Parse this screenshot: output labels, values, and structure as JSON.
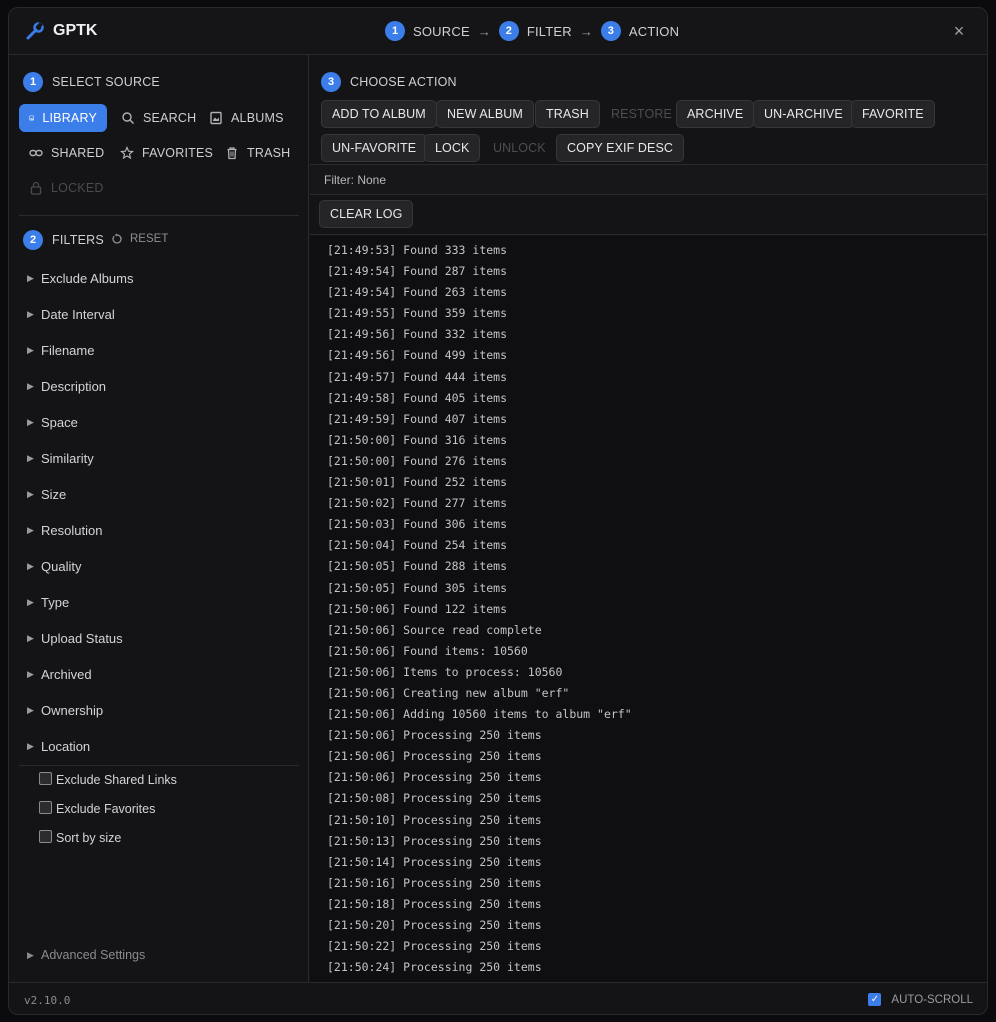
{
  "app": {
    "title": "GPTK",
    "version": "v2.10.0"
  },
  "steps": [
    {
      "num": "1",
      "label": "SOURCE"
    },
    {
      "num": "2",
      "label": "FILTER"
    },
    {
      "num": "3",
      "label": "ACTION"
    }
  ],
  "step_arrow": "→",
  "close_icon": "×",
  "source": {
    "num": "1",
    "title": "SELECT SOURCE",
    "buttons": [
      {
        "label": "LIBRARY",
        "icon": "image-icon",
        "state": "active"
      },
      {
        "label": "SEARCH",
        "icon": "search-icon",
        "state": "normal"
      },
      {
        "label": "ALBUMS",
        "icon": "album-icon",
        "state": "normal"
      },
      {
        "label": "SHARED",
        "icon": "link-icon",
        "state": "normal"
      },
      {
        "label": "FAVORITES",
        "icon": "star-icon",
        "state": "normal"
      },
      {
        "label": "TRASH",
        "icon": "trash-icon",
        "state": "normal"
      },
      {
        "label": "LOCKED",
        "icon": "lock-icon",
        "state": "disabled"
      }
    ]
  },
  "filters": {
    "num": "2",
    "title": "FILTERS",
    "reset_label": "RESET",
    "items": [
      "Exclude Albums",
      "Date Interval",
      "Filename",
      "Description",
      "Space",
      "Similarity",
      "Size",
      "Resolution",
      "Quality",
      "Type",
      "Upload Status",
      "Archived",
      "Ownership",
      "Location"
    ],
    "checkboxes": [
      {
        "label": "Exclude Shared Links",
        "checked": false
      },
      {
        "label": "Exclude Favorites",
        "checked": false
      },
      {
        "label": "Sort by size",
        "checked": false
      }
    ],
    "advanced_label": "Advanced Settings"
  },
  "actions": {
    "num": "3",
    "title": "CHOOSE ACTION",
    "buttons": [
      {
        "label": "ADD TO ALBUM",
        "enabled": true
      },
      {
        "label": "NEW ALBUM",
        "enabled": true
      },
      {
        "label": "TRASH",
        "enabled": true
      },
      {
        "label": "RESTORE",
        "enabled": false
      },
      {
        "label": "ARCHIVE",
        "enabled": true
      },
      {
        "label": "UN-ARCHIVE",
        "enabled": true
      },
      {
        "label": "FAVORITE",
        "enabled": true
      },
      {
        "label": "UN-FAVORITE",
        "enabled": true
      },
      {
        "label": "LOCK",
        "enabled": true
      },
      {
        "label": "UNLOCK",
        "enabled": false
      },
      {
        "label": "COPY EXIF DESC",
        "enabled": true
      }
    ]
  },
  "filter_status": "Filter: None",
  "clear_log_label": "CLEAR LOG",
  "log": [
    "[21:49:53] Found 333 items",
    "[21:49:54] Found 287 items",
    "[21:49:54] Found 263 items",
    "[21:49:55] Found 359 items",
    "[21:49:56] Found 332 items",
    "[21:49:56] Found 499 items",
    "[21:49:57] Found 444 items",
    "[21:49:58] Found 405 items",
    "[21:49:59] Found 407 items",
    "[21:50:00] Found 316 items",
    "[21:50:00] Found 276 items",
    "[21:50:01] Found 252 items",
    "[21:50:02] Found 277 items",
    "[21:50:03] Found 306 items",
    "[21:50:04] Found 254 items",
    "[21:50:05] Found 288 items",
    "[21:50:05] Found 305 items",
    "[21:50:06] Found 122 items",
    "[21:50:06] Source read complete",
    "[21:50:06] Found items: 10560",
    "[21:50:06] Items to process: 10560",
    "[21:50:06] Creating new album \"erf\"",
    "[21:50:06] Adding 10560 items to album \"erf\"",
    "[21:50:06] Processing 250 items",
    "[21:50:06] Processing 250 items",
    "[21:50:06] Processing 250 items",
    "[21:50:08] Processing 250 items",
    "[21:50:10] Processing 250 items",
    "[21:50:13] Processing 250 items",
    "[21:50:14] Processing 250 items",
    "[21:50:16] Processing 250 items",
    "[21:50:18] Processing 250 items",
    "[21:50:20] Processing 250 items",
    "[21:50:22] Processing 250 items",
    "[21:50:24] Processing 250 items"
  ],
  "autoscroll": {
    "label": "AUTO-SCROLL",
    "checked": true
  },
  "colors": {
    "accent": "#3b7de9",
    "background": "#141416",
    "log_bg": "#0f0f11"
  }
}
